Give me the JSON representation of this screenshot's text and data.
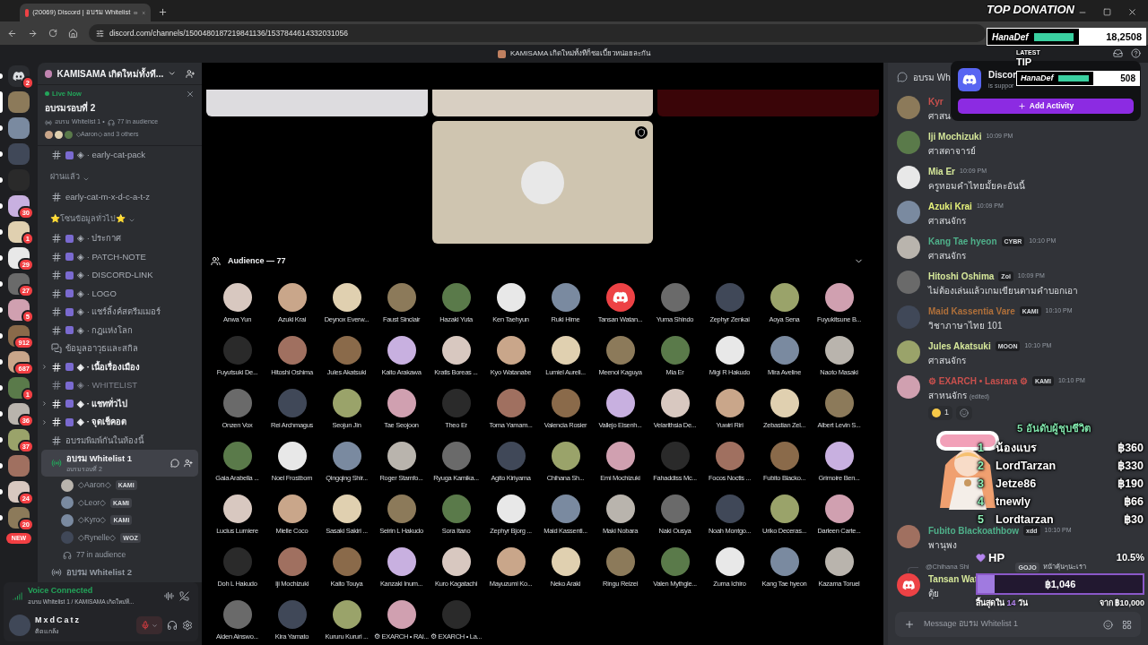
{
  "browser": {
    "tab_title": "(20069) Discord | อบรม Whitelist",
    "url": "discord.com/channels/1500480187219841136/1537844614332031056",
    "window_title": "KAMISAMA เกิดใหม่ทั้งทีก็ชอเบี้ยวหน่อยละกัน"
  },
  "servers": [
    {
      "kind": "home",
      "badge": "2",
      "selected": false
    },
    {
      "kind": "server",
      "selected": true
    },
    {
      "kind": "server",
      "selected": false
    },
    {
      "kind": "server",
      "selected": false
    },
    {
      "kind": "server",
      "selected": false
    },
    {
      "kind": "server",
      "badge": "30",
      "selected": false
    },
    {
      "kind": "server",
      "badge": "1",
      "selected": false
    },
    {
      "kind": "server",
      "badge": "29",
      "selected": false
    },
    {
      "kind": "server",
      "badge": "27",
      "selected": false
    },
    {
      "kind": "server",
      "badge": "5",
      "selected": false
    },
    {
      "kind": "server",
      "badge": "912",
      "selected": false
    },
    {
      "kind": "server",
      "badge": "687",
      "selected": false
    },
    {
      "kind": "server",
      "badge": "1",
      "selected": false
    },
    {
      "kind": "server",
      "badge": "36",
      "selected": false
    },
    {
      "kind": "server",
      "badge": "37",
      "selected": false
    },
    {
      "kind": "server",
      "selected": false
    },
    {
      "kind": "server",
      "badge": "24",
      "selected": false
    },
    {
      "kind": "server",
      "badge": "20",
      "selected": false
    }
  ],
  "new_pill": "NEW",
  "server_name": "KAMISAMA เกิดใหม่ทั้งที...",
  "live": {
    "label": "Live Now",
    "title": "อบรมรอบที่ 2",
    "channel": "อบรม Whitelist 1 •",
    "audience": "77 in audience",
    "speakers": "◇Aaron◇ and 3 others"
  },
  "channels": [
    {
      "kind": "text",
      "prefix": "◈ ·",
      "name": "early-cat-pack",
      "unread": false,
      "muted": false
    },
    {
      "kind": "category",
      "name": "ผ่านแล้ว"
    },
    {
      "kind": "text",
      "name": "early-cat-m-x-d-c-a-t-z",
      "unread": false,
      "muted": false
    },
    {
      "kind": "category",
      "name": "⭐โซนข้อมูลทั่วไป⭐"
    },
    {
      "kind": "text",
      "prefix": "◈ ·",
      "name": "ประกาศ",
      "unread": false,
      "muted": false
    },
    {
      "kind": "text",
      "prefix": "◈ ·",
      "name": "PATCH-NOTE",
      "unread": false,
      "muted": false
    },
    {
      "kind": "text",
      "prefix": "◈ ·",
      "name": "DISCORD-LINK",
      "unread": false,
      "muted": false
    },
    {
      "kind": "text",
      "prefix": "◈ ·",
      "name": "LOGO",
      "unread": false,
      "muted": false
    },
    {
      "kind": "text",
      "prefix": "◈ ·",
      "name": "แชร์ลิ้งค์สตรีมเมอร์",
      "unread": false,
      "muted": false
    },
    {
      "kind": "text",
      "prefix": "◈ ·",
      "name": "กฎแห่งโลก",
      "unread": false,
      "muted": false
    },
    {
      "kind": "forum",
      "name": "ข้อมูลอาวุธและสกิล",
      "unread": false,
      "muted": false
    },
    {
      "kind": "text",
      "prefix": "◈ ·",
      "name": "เนื้อเรื่องเมือง",
      "unread": true,
      "muted": false
    },
    {
      "kind": "text",
      "prefix": "◈ ·",
      "name": "WHITELIST",
      "unread": false,
      "muted": true
    },
    {
      "kind": "text",
      "prefix": "◈ ·",
      "name": "แชททั่วไป",
      "unread": true,
      "muted": false
    },
    {
      "kind": "text",
      "prefix": "◈ ·",
      "name": "จุดเช็คอต",
      "unread": true,
      "muted": false
    },
    {
      "kind": "text",
      "name": "อบรมพิมพ์กันในห้องนี้",
      "unread": false,
      "muted": false
    },
    {
      "kind": "voice",
      "name": "อบรม Whitelist 1",
      "sub": "อบรมรอบที่ 2",
      "selected": true
    },
    {
      "kind": "member",
      "name": "◇Aaron◇",
      "tag": "KAMI"
    },
    {
      "kind": "member",
      "name": "◇Leor◇",
      "tag": "KAMI"
    },
    {
      "kind": "member",
      "name": "◇Kyro◇",
      "tag": "KAMI"
    },
    {
      "kind": "member",
      "name": "◇Rynelle◇",
      "tag": "WOZ"
    },
    {
      "kind": "audience",
      "name": "77 in audience"
    },
    {
      "kind": "voice",
      "name": "อบรม Whitelist 2",
      "selected": false
    }
  ],
  "voice": {
    "status": "Voice Connected",
    "location": "อบรม Whitelist 1 / KAMISAMA เกิดใหม่ที..."
  },
  "user": {
    "name": "MxdCatz",
    "status": "ติดแกล้ง"
  },
  "stage": {
    "audience_title": "Audience — 77",
    "audience": [
      {
        "name": "Anwa Yun"
      },
      {
        "name": "Azuki Krai"
      },
      {
        "name": "Deynox Everw..."
      },
      {
        "name": "Faust Sinclair"
      },
      {
        "name": "Hazaki Yuta"
      },
      {
        "name": "Ken Taehyun"
      },
      {
        "name": "Ruki Hime"
      },
      {
        "name": "Tansan Watan...",
        "kind": "discord"
      },
      {
        "name": "Yuma Shindo"
      },
      {
        "name": "Zephyr Zenkai"
      },
      {
        "name": "Aoya Sena"
      },
      {
        "name": "Fuyukitsune B..."
      },
      {
        "name": "Fuyutsuki De..."
      },
      {
        "name": "Hitoshi Oshima"
      },
      {
        "name": "Jules Akatsuki"
      },
      {
        "name": "Kaito Arakawa"
      },
      {
        "name": "Kratis Boreas ..."
      },
      {
        "name": "Kyo Watanabe"
      },
      {
        "name": "Lumiel Aureli..."
      },
      {
        "name": "Meenoi Kaguya"
      },
      {
        "name": "Mia Er"
      },
      {
        "name": "Migi R Hakudo"
      },
      {
        "name": "Mira Aveline"
      },
      {
        "name": "Naoto Masaki"
      },
      {
        "name": "Onzen Vox"
      },
      {
        "name": "Rei Archmagus"
      },
      {
        "name": "Seojun Jin"
      },
      {
        "name": "Tae Seojoon"
      },
      {
        "name": "Theo Er"
      },
      {
        "name": "Toma Yamam..."
      },
      {
        "name": "Valencia Rosier"
      },
      {
        "name": "Vallejo Eisenh..."
      },
      {
        "name": "Velarithsia De..."
      },
      {
        "name": "Yuwiri Riri"
      },
      {
        "name": "Zebastian Zel..."
      },
      {
        "name": "Albert Levin S..."
      },
      {
        "name": "Gaia Arabella ..."
      },
      {
        "name": "Noel Frostborn"
      },
      {
        "name": "Qingqing Shir..."
      },
      {
        "name": "Roger Stamfo..."
      },
      {
        "name": "Ryuga Kamika..."
      },
      {
        "name": "Agito Kiriyama"
      },
      {
        "name": "Chihana Sh..."
      },
      {
        "name": "Emi Mochizuki"
      },
      {
        "name": "Fahaddiss Mc..."
      },
      {
        "name": "Focos Noctis ..."
      },
      {
        "name": "Fubito Blacko..."
      },
      {
        "name": "Grimoire Ben..."
      },
      {
        "name": "Lucius Lumiere"
      },
      {
        "name": "Mielle Coco"
      },
      {
        "name": "Sasaki Sakiri ..."
      },
      {
        "name": "Seirin L Hakudo"
      },
      {
        "name": "Sora Itano"
      },
      {
        "name": "Zephyr Bjorg ..."
      },
      {
        "name": "Maid Kassenti..."
      },
      {
        "name": "Maki Nobara"
      },
      {
        "name": "Naki Ousya"
      },
      {
        "name": "Noah Montgo..."
      },
      {
        "name": "Uriko Deceras..."
      },
      {
        "name": "Darleen Carte..."
      },
      {
        "name": "Doh L Hakudo"
      },
      {
        "name": "Iji Mochizuki"
      },
      {
        "name": "Kaito Touya"
      },
      {
        "name": "Kanzaki Inum..."
      },
      {
        "name": "Kuro Kagatachi"
      },
      {
        "name": "Mayuzumi Ko..."
      },
      {
        "name": "Neko Araki"
      },
      {
        "name": "Ringu Reizei"
      },
      {
        "name": "Valen Mythgle..."
      },
      {
        "name": "Zuma Ichiro"
      },
      {
        "name": "Kang Tae hyeon"
      },
      {
        "name": "Kazama Toruel"
      },
      {
        "name": "Aiden Ainswo..."
      },
      {
        "name": "Kira Yamato"
      },
      {
        "name": "Kururu Kururi ..."
      },
      {
        "name": "⚙ EXARCH • RAI..."
      },
      {
        "name": "⚙ EXARCH • La..."
      }
    ]
  },
  "chat": {
    "header": "อบรม Whi",
    "placeholder": "Message อบรม Whitelist 1",
    "messages": [
      {
        "kind": "message",
        "default_avatar": false,
        "author": "Kyr",
        "color": "#c9504d",
        "text": "ศาสน"
      },
      {
        "kind": "message",
        "default_avatar": false,
        "author": "Iji Mochizuki",
        "color": "#d6e89a",
        "time": "10:09 PM",
        "text": "ศาสดาจารย์"
      },
      {
        "kind": "message",
        "default_avatar": false,
        "author": "Mia Er",
        "color": "#d6e89a",
        "time": "10:09 PM",
        "text": "ครูหอมคำไทยมั้ยคะอันนี้"
      },
      {
        "kind": "message",
        "default_avatar": false,
        "author": "Azuki Krai",
        "color": "#e6f27a",
        "time": "10:09 PM",
        "text": "ศาสนจักร"
      },
      {
        "kind": "message",
        "default_avatar": false,
        "author": "Kang Tae hyeon",
        "color": "#4fb08a",
        "tag": "CYBR",
        "time": "10:10 PM",
        "text": "ศาสนจักร"
      },
      {
        "kind": "message",
        "default_avatar": false,
        "author": "Hitoshi Oshima",
        "color": "#d6e89a",
        "tag": "Zoi",
        "time": "10:09 PM",
        "text": "ไม่ต้องเล่นแล้วเกมเขียนตามคำบอกเอา"
      },
      {
        "kind": "message",
        "default_avatar": false,
        "author": "Maid Kassentia Vare",
        "color": "#b0703a",
        "tag": "KAMI",
        "time": "10:10 PM",
        "text": "วิชาภาษาไทย 101"
      },
      {
        "kind": "message",
        "default_avatar": false,
        "author": "Jules Akatsuki",
        "color": "#d6e89a",
        "tag": "MOON",
        "time": "10:10 PM",
        "text": "ศาสนจักร"
      },
      {
        "kind": "message",
        "default_avatar": false,
        "author": "⚙ EXARCH • Lasrara ⚙",
        "color": "#c9504d",
        "tag": "KAMI",
        "time": "10:10 PM",
        "text": "สาหนจักร",
        "edited_label": "(edited)",
        "reaction_count": "1"
      },
      {
        "kind": "sticker"
      },
      {
        "kind": "message",
        "default_avatar": false,
        "author": "Fubito Blackoathbow",
        "color": "#4fb08a",
        "tag": "xdd",
        "time": "10:10 PM",
        "text": "พานุพง"
      },
      {
        "kind": "message",
        "default_avatar": true,
        "author": "Tansan Wat",
        "color": "#d6e89a",
        "text": "ตุ้ย",
        "reply": {
          "to": "@Chihana Shi",
          "tag": "GOJO",
          "text": "หน้าคุ้นๆนะเรา"
        }
      }
    ]
  },
  "activity_popup": {
    "title": "Discor",
    "subtitle": "is suppor",
    "button": "Add Activity"
  },
  "leaderboard": {
    "title": "5 อันดับผู้ชุบชีวิต",
    "rows": [
      {
        "rank": "1",
        "name": "น้องแบร",
        "amount": "฿360"
      },
      {
        "rank": "2",
        "name": "LordTarzan",
        "amount": "฿330"
      },
      {
        "rank": "3",
        "name": "Jetze86",
        "amount": "฿190"
      },
      {
        "rank": "4",
        "name": "tnewly",
        "amount": "฿66"
      },
      {
        "rank": "5",
        "name": "Lordtarzan",
        "amount": "฿30"
      }
    ]
  },
  "goal": {
    "label": "HP",
    "percent": "10.5%",
    "level": 0.105,
    "amount": "฿1,046",
    "ends_prefix": "สิ้นสุดใน",
    "days": "14",
    "ends_suffix": "วัน",
    "target": "จาก ฿10,000"
  },
  "top_donation": {
    "title": "TOP DONATION",
    "name": "HanaDef",
    "amount": "18,2508"
  },
  "latest_tip": {
    "title_1": "LATEST",
    "title_2": "TIP",
    "name": "HanaDef",
    "amount": "508"
  }
}
